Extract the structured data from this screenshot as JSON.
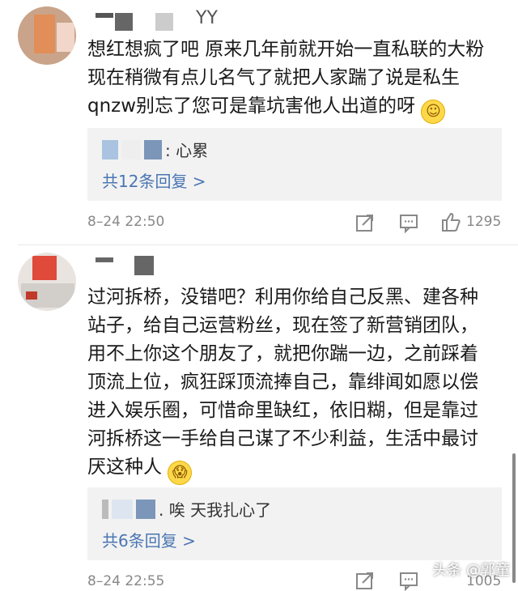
{
  "comments": [
    {
      "username_suffix": "YY",
      "text_lines": [
        "想红想疯了吧  原来几年前就开始一直私联的大粉",
        "现在稍微有点儿名气了就把人家踹了说是私生",
        "qnzw别忘了您可是靠坑害他人出道的呀"
      ],
      "emoji": "slight-smile",
      "reply_preview": ": 心累",
      "reply_count": "共12条回复 >",
      "time": "8–24 22:50",
      "likes": "1295"
    },
    {
      "username_suffix": "",
      "text_lines": [
        "过河拆桥，没错吧？利用你给自己反黑、建各种",
        "站子，给自己运营粉丝，现在签了新营销团队，",
        "用不上你这个朋友了，就把你踹一边，之前踩着",
        "顶流上位，疯狂踩顶流捧自己，靠绯闻如愿以偿",
        "进入娱乐圈，可惜命里缺红，依旧糊，但是靠过",
        "河拆桥这一手给自己谋了不少利益，生活中最讨",
        "厌这种人"
      ],
      "emoji": "fearful-face",
      "reply_preview_prefix": "",
      "reply_preview": ". 唉 天我扎心了",
      "reply_count": "共6条回复 >",
      "time": "8–24 22:55",
      "likes": "1005"
    }
  ],
  "watermark": "头条 @郭童",
  "colors": {
    "link": "#4a76b3",
    "meta": "#888888",
    "reply_bg": "#f2f2f2"
  }
}
